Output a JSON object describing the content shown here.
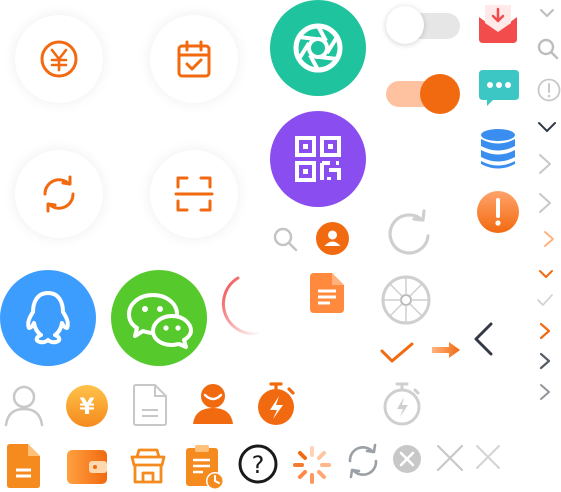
{
  "icon_sheet": {
    "colors": {
      "orange": "#f26a10",
      "orange_light": "#ffa065",
      "teal": "#1fc39e",
      "purple": "#8a4ef0",
      "blue": "#3d9dff",
      "green": "#56c92c",
      "red": "#f24c4c",
      "gray": "#c8c8c8",
      "dark": "#333a45",
      "db_blue": "#3a8ef0",
      "message_teal": "#3cc7c4"
    },
    "icons": [
      "yen-circle-icon",
      "calendar-check-icon",
      "refresh-icon",
      "scan-frame-icon",
      "camera-aperture-icon",
      "qr-code-icon",
      "search-icon",
      "user-badge-icon",
      "qq-penguin-icon",
      "wechat-icon",
      "loading-arc-icon",
      "document-icon",
      "toggle-off",
      "toggle-on",
      "mail-download-icon",
      "chat-more-icon",
      "database-icon",
      "alert-icon",
      "reload-icon",
      "wheel-icon",
      "checkmark-icon",
      "arrow-right-icon",
      "chevron-left-icon",
      "user-outline-icon",
      "yen-coin-icon",
      "file-outline-icon",
      "user-avatar-icon",
      "stopwatch-flash-icon",
      "stopwatch-outline-icon",
      "document-solid-icon",
      "wallet-icon",
      "shop-icon",
      "clipboard-clock-icon",
      "question-icon",
      "spinner-icon",
      "sync-icon",
      "close-circle-icon",
      "close-icon",
      "close-light-icon"
    ],
    "labels": {
      "question_mark": "?",
      "yen_sign": "¥"
    }
  }
}
